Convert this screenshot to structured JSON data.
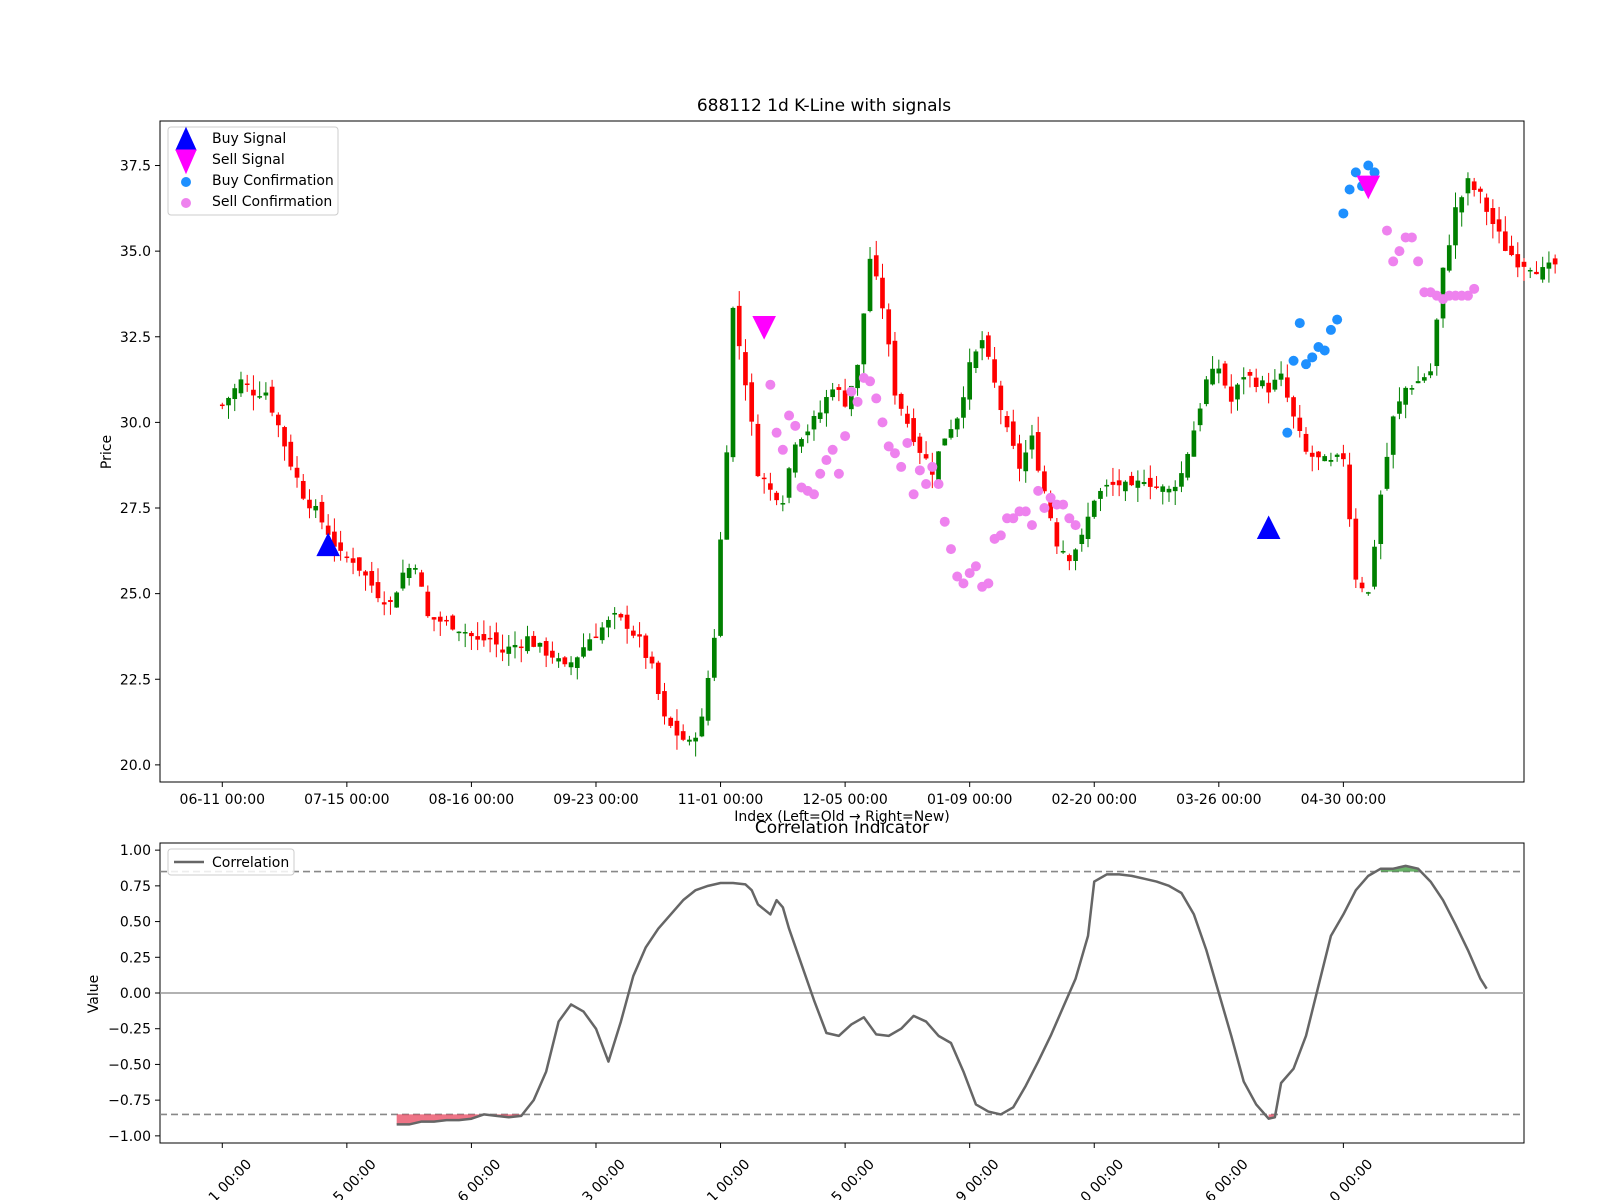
{
  "chart_data": [
    {
      "type": "candlestick",
      "title": "688112 1d K-Line with signals",
      "xlabel": "Index (Left=Old → Right=New)",
      "ylabel": "Price",
      "ylim": [
        19.5,
        38.8
      ],
      "y_ticks": [
        "20.0",
        "22.5",
        "25.0",
        "27.5",
        "30.0",
        "32.5",
        "35.0",
        "37.5"
      ],
      "y_tick_values": [
        20.0,
        22.5,
        25.0,
        27.5,
        30.0,
        32.5,
        35.0,
        37.5
      ],
      "x_ticks": [
        "06-11 00:00",
        "07-15 00:00",
        "08-16 00:00",
        "09-23 00:00",
        "11-01 00:00",
        "12-05 00:00",
        "01-09 00:00",
        "02-20 00:00",
        "03-26 00:00",
        "04-30 00:00"
      ],
      "x_tick_index": [
        0,
        20,
        40,
        60,
        80,
        100,
        120,
        140,
        160,
        180
      ],
      "xlim": [
        -10,
        209
      ],
      "legend_position": "upper-left",
      "legend": [
        {
          "label": "Buy Signal",
          "marker": "triangle-up",
          "color": "#0000ff"
        },
        {
          "label": "Sell Signal",
          "marker": "triangle-down",
          "color": "#ff00ff"
        },
        {
          "label": "Buy Confirmation",
          "marker": "circle",
          "color": "#1e90ff"
        },
        {
          "label": "Sell Confirmation",
          "marker": "circle",
          "color": "#ee82ee"
        }
      ],
      "colors": {
        "up": "#008000",
        "down": "#ff0000"
      },
      "close_path": [
        [
          0,
          30.5
        ],
        [
          3,
          31.2
        ],
        [
          5,
          30.9
        ],
        [
          7,
          30.9
        ],
        [
          9,
          29.9
        ],
        [
          11,
          28.8
        ],
        [
          13,
          27.9
        ],
        [
          15,
          27.4
        ],
        [
          17,
          26.8
        ],
        [
          19,
          26.1
        ],
        [
          21,
          26.0
        ],
        [
          23,
          25.5
        ],
        [
          25,
          25.0
        ],
        [
          27,
          24.7
        ],
        [
          29,
          25.6
        ],
        [
          31,
          25.9
        ],
        [
          33,
          24.3
        ],
        [
          35,
          24.2
        ],
        [
          37,
          24.1
        ],
        [
          39,
          23.9
        ],
        [
          41,
          23.6
        ],
        [
          43,
          23.7
        ],
        [
          45,
          23.3
        ],
        [
          47,
          23.5
        ],
        [
          49,
          23.7
        ],
        [
          51,
          23.4
        ],
        [
          53,
          23.2
        ],
        [
          55,
          22.8
        ],
        [
          57,
          23.2
        ],
        [
          59,
          23.7
        ],
        [
          61,
          24.0
        ],
        [
          63,
          24.3
        ],
        [
          65,
          24.1
        ],
        [
          67,
          23.6
        ],
        [
          69,
          22.8
        ],
        [
          71,
          21.3
        ],
        [
          73,
          20.9
        ],
        [
          75,
          20.6
        ],
        [
          77,
          21.3
        ],
        [
          79,
          23.8
        ],
        [
          81,
          29.3
        ],
        [
          82,
          33.3
        ],
        [
          84,
          31.2
        ],
        [
          86,
          28.6
        ],
        [
          88,
          28.0
        ],
        [
          90,
          27.8
        ],
        [
          92,
          29.5
        ],
        [
          94,
          29.8
        ],
        [
          96,
          30.3
        ],
        [
          98,
          31.1
        ],
        [
          100,
          30.6
        ],
        [
          102,
          31.6
        ],
        [
          104,
          34.8
        ],
        [
          106,
          33.4
        ],
        [
          108,
          30.9
        ],
        [
          110,
          30.0
        ],
        [
          112,
          29.2
        ],
        [
          114,
          28.6
        ],
        [
          116,
          29.6
        ],
        [
          118,
          30.2
        ],
        [
          120,
          31.6
        ],
        [
          122,
          32.4
        ],
        [
          124,
          31.1
        ],
        [
          126,
          29.7
        ],
        [
          128,
          28.7
        ],
        [
          130,
          29.5
        ],
        [
          132,
          28.0
        ],
        [
          134,
          26.5
        ],
        [
          136,
          26.1
        ],
        [
          138,
          26.6
        ],
        [
          140,
          27.8
        ],
        [
          142,
          28.1
        ],
        [
          144,
          28.2
        ],
        [
          146,
          28.0
        ],
        [
          148,
          28.4
        ],
        [
          150,
          28.1
        ],
        [
          152,
          28.0
        ],
        [
          154,
          28.5
        ],
        [
          156,
          29.8
        ],
        [
          158,
          31.2
        ],
        [
          160,
          31.6
        ],
        [
          162,
          30.6
        ],
        [
          164,
          31.4
        ],
        [
          166,
          31.2
        ],
        [
          168,
          31.0
        ],
        [
          170,
          31.3
        ],
        [
          172,
          30.1
        ],
        [
          174,
          29.1
        ],
        [
          176,
          28.9
        ],
        [
          178,
          28.8
        ],
        [
          180,
          29.0
        ],
        [
          182,
          25.5
        ],
        [
          184,
          25.0
        ],
        [
          186,
          27.9
        ],
        [
          188,
          30.1
        ],
        [
          190,
          31.0
        ],
        [
          192,
          31.2
        ],
        [
          194,
          31.5
        ],
        [
          196,
          34.4
        ],
        [
          198,
          36.2
        ],
        [
          200,
          37.0
        ],
        [
          202,
          36.6
        ],
        [
          204,
          35.8
        ],
        [
          206,
          35.1
        ],
        [
          208,
          34.7
        ],
        [
          210,
          34.6
        ],
        [
          212,
          34.4
        ],
        [
          214,
          34.6
        ]
      ],
      "buy_signals": [
        {
          "index": 17,
          "price": 26.4
        },
        {
          "index": 168,
          "price": 26.9
        }
      ],
      "sell_signals": [
        {
          "index": 87,
          "price": 32.8
        },
        {
          "index": 184,
          "price": 36.9
        }
      ],
      "buy_confirmations": [
        [
          171,
          29.7
        ],
        [
          172,
          31.8
        ],
        [
          173,
          32.9
        ],
        [
          174,
          31.7
        ],
        [
          175,
          31.9
        ],
        [
          176,
          32.2
        ],
        [
          177,
          32.1
        ],
        [
          178,
          32.7
        ],
        [
          179,
          33.0
        ],
        [
          180,
          36.1
        ],
        [
          181,
          36.8
        ],
        [
          182,
          37.3
        ],
        [
          183,
          36.9
        ],
        [
          184,
          37.5
        ],
        [
          185,
          37.3
        ]
      ],
      "sell_confirmations": [
        [
          88,
          31.1
        ],
        [
          89,
          29.7
        ],
        [
          90,
          29.2
        ],
        [
          91,
          30.2
        ],
        [
          92,
          29.9
        ],
        [
          93,
          28.1
        ],
        [
          94,
          28.0
        ],
        [
          95,
          27.9
        ],
        [
          96,
          28.5
        ],
        [
          97,
          28.9
        ],
        [
          98,
          29.2
        ],
        [
          99,
          28.5
        ],
        [
          100,
          29.6
        ],
        [
          101,
          30.9
        ],
        [
          102,
          30.6
        ],
        [
          103,
          31.3
        ],
        [
          104,
          31.2
        ],
        [
          105,
          30.7
        ],
        [
          106,
          30.0
        ],
        [
          107,
          29.3
        ],
        [
          108,
          29.1
        ],
        [
          109,
          28.7
        ],
        [
          110,
          29.4
        ],
        [
          111,
          27.9
        ],
        [
          112,
          28.6
        ],
        [
          113,
          28.2
        ],
        [
          114,
          28.7
        ],
        [
          115,
          28.2
        ],
        [
          116,
          27.1
        ],
        [
          117,
          26.3
        ],
        [
          118,
          25.5
        ],
        [
          119,
          25.3
        ],
        [
          120,
          25.6
        ],
        [
          121,
          25.8
        ],
        [
          122,
          25.2
        ],
        [
          123,
          25.3
        ],
        [
          124,
          26.6
        ],
        [
          125,
          26.7
        ],
        [
          126,
          27.2
        ],
        [
          127,
          27.2
        ],
        [
          128,
          27.4
        ],
        [
          129,
          27.4
        ],
        [
          130,
          27.0
        ],
        [
          131,
          28.0
        ],
        [
          132,
          27.5
        ],
        [
          133,
          27.8
        ],
        [
          134,
          27.6
        ],
        [
          135,
          27.6
        ],
        [
          136,
          27.2
        ],
        [
          137,
          27.0
        ],
        [
          187,
          35.6
        ],
        [
          188,
          34.7
        ],
        [
          189,
          35.0
        ],
        [
          190,
          35.4
        ],
        [
          191,
          35.4
        ],
        [
          192,
          34.7
        ],
        [
          193,
          33.8
        ],
        [
          194,
          33.8
        ],
        [
          195,
          33.7
        ],
        [
          196,
          33.6
        ],
        [
          197,
          33.7
        ],
        [
          198,
          33.7
        ],
        [
          199,
          33.7
        ],
        [
          200,
          33.7
        ],
        [
          201,
          33.9
        ]
      ]
    },
    {
      "type": "line",
      "title": "Correlation Indicator",
      "ylabel": "Value",
      "ylim": [
        -1.05,
        1.05
      ],
      "y_ticks": [
        "−1.00",
        "−0.75",
        "−0.50",
        "−0.25",
        "0.00",
        "0.25",
        "0.50",
        "0.75",
        "1.00"
      ],
      "y_tick_values": [
        -1.0,
        -0.75,
        -0.5,
        -0.25,
        0.0,
        0.25,
        0.5,
        0.75,
        1.0
      ],
      "x_ticks": [
        "1 00:00",
        "5 00:00",
        "6 00:00",
        "3 00:00",
        "1 00:00",
        "5 00:00",
        "9 00:00",
        "0 00:00",
        "6 00:00",
        "0 00:00"
      ],
      "x_tick_index": [
        0,
        20,
        40,
        60,
        80,
        100,
        120,
        140,
        160,
        180
      ],
      "xlim": [
        -10,
        209
      ],
      "thresholds": [
        0.85,
        -0.85
      ],
      "zero_line": 0.0,
      "legend_position": "upper-left",
      "series": [
        {
          "name": "Correlation",
          "color": "#666666",
          "points": [
            [
              28,
              -0.92
            ],
            [
              30,
              -0.92
            ],
            [
              32,
              -0.9
            ],
            [
              34,
              -0.9
            ],
            [
              36,
              -0.89
            ],
            [
              38,
              -0.89
            ],
            [
              40,
              -0.88
            ],
            [
              42,
              -0.85
            ],
            [
              44,
              -0.86
            ],
            [
              46,
              -0.87
            ],
            [
              48,
              -0.86
            ],
            [
              50,
              -0.75
            ],
            [
              52,
              -0.55
            ],
            [
              54,
              -0.2
            ],
            [
              56,
              -0.08
            ],
            [
              58,
              -0.13
            ],
            [
              60,
              -0.25
            ],
            [
              62,
              -0.48
            ],
            [
              64,
              -0.2
            ],
            [
              66,
              0.12
            ],
            [
              68,
              0.32
            ],
            [
              70,
              0.45
            ],
            [
              72,
              0.55
            ],
            [
              74,
              0.65
            ],
            [
              76,
              0.72
            ],
            [
              78,
              0.75
            ],
            [
              80,
              0.77
            ],
            [
              82,
              0.77
            ],
            [
              84,
              0.76
            ],
            [
              85,
              0.72
            ],
            [
              86,
              0.62
            ],
            [
              88,
              0.55
            ],
            [
              89,
              0.65
            ],
            [
              90,
              0.6
            ],
            [
              91,
              0.45
            ],
            [
              93,
              0.2
            ],
            [
              95,
              -0.05
            ],
            [
              97,
              -0.28
            ],
            [
              99,
              -0.3
            ],
            [
              101,
              -0.22
            ],
            [
              103,
              -0.17
            ],
            [
              105,
              -0.29
            ],
            [
              107,
              -0.3
            ],
            [
              109,
              -0.25
            ],
            [
              111,
              -0.16
            ],
            [
              113,
              -0.2
            ],
            [
              115,
              -0.3
            ],
            [
              117,
              -0.35
            ],
            [
              119,
              -0.55
            ],
            [
              121,
              -0.78
            ],
            [
              123,
              -0.83
            ],
            [
              125,
              -0.85
            ],
            [
              127,
              -0.8
            ],
            [
              129,
              -0.65
            ],
            [
              131,
              -0.48
            ],
            [
              133,
              -0.3
            ],
            [
              135,
              -0.1
            ],
            [
              137,
              0.1
            ],
            [
              139,
              0.4
            ],
            [
              140,
              0.78
            ],
            [
              142,
              0.83
            ],
            [
              144,
              0.83
            ],
            [
              146,
              0.82
            ],
            [
              148,
              0.8
            ],
            [
              150,
              0.78
            ],
            [
              152,
              0.75
            ],
            [
              154,
              0.7
            ],
            [
              156,
              0.55
            ],
            [
              158,
              0.3
            ],
            [
              160,
              0.0
            ],
            [
              162,
              -0.3
            ],
            [
              164,
              -0.62
            ],
            [
              166,
              -0.78
            ],
            [
              168,
              -0.88
            ],
            [
              169,
              -0.87
            ],
            [
              170,
              -0.63
            ],
            [
              172,
              -0.53
            ],
            [
              174,
              -0.3
            ],
            [
              176,
              0.05
            ],
            [
              178,
              0.4
            ],
            [
              180,
              0.55
            ],
            [
              182,
              0.72
            ],
            [
              184,
              0.82
            ],
            [
              186,
              0.87
            ],
            [
              188,
              0.87
            ],
            [
              190,
              0.89
            ],
            [
              192,
              0.87
            ],
            [
              194,
              0.78
            ],
            [
              196,
              0.65
            ],
            [
              198,
              0.48
            ],
            [
              200,
              0.3
            ],
            [
              202,
              0.1
            ],
            [
              203,
              0.03
            ]
          ]
        }
      ]
    }
  ]
}
